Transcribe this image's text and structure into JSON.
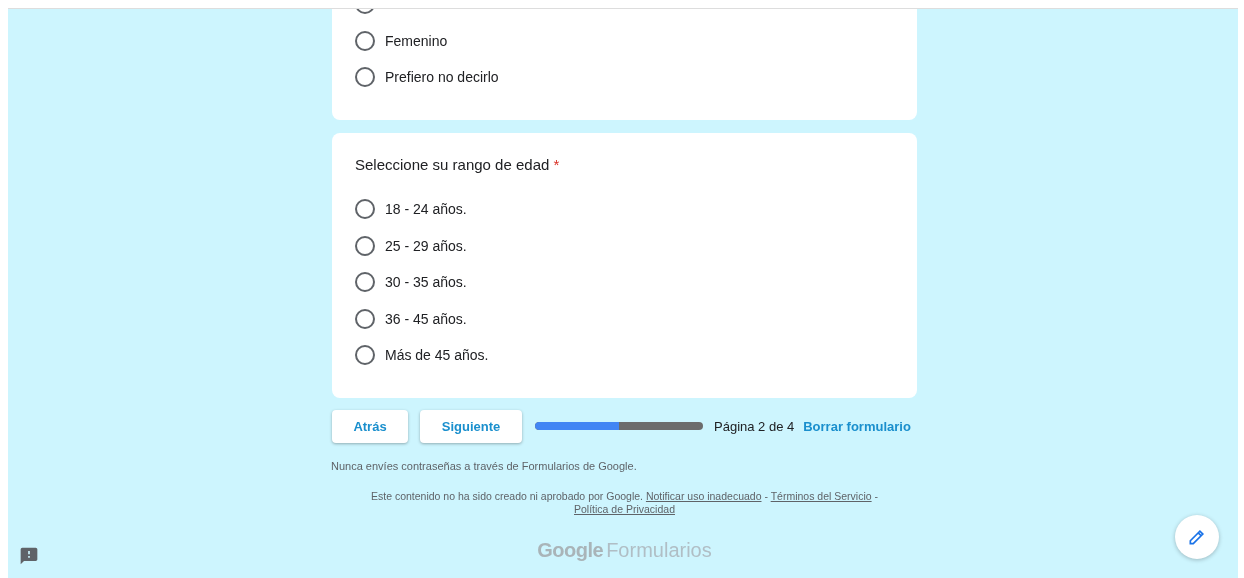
{
  "sections": [
    {
      "options": [
        {
          "selected": false
        },
        {
          "label": "Femenino",
          "selected": false
        },
        {
          "label": "Prefiero no decirlo",
          "selected": false
        }
      ]
    },
    {
      "question": "Seleccione su rango de edad",
      "required_mark": "*",
      "options": [
        {
          "label": "18 - 24 años.",
          "selected": false
        },
        {
          "label": "25 - 29 años.",
          "selected": false
        },
        {
          "label": "30 - 35 años.",
          "selected": false
        },
        {
          "label": "36 - 45 años.",
          "selected": false
        },
        {
          "label": "Más de 45 años.",
          "selected": false
        }
      ]
    }
  ],
  "navigation": {
    "back": "Atrás",
    "next": "Siguiente",
    "progress": {
      "level": 0.5
    },
    "page_label": "Página 2 de 4",
    "clear": "Borrar formulario"
  },
  "footer": {
    "warning": "Nunca envíes contraseñas a través de Formularios de Google.",
    "disclaimer": "Este contenido no ha sido creado ni aprobado por Google.",
    "links": [
      "Notificar uso inadecuado",
      "Términos del Servicio",
      "Política de Privacidad"
    ],
    "separator": "-",
    "logo_google": "Google",
    "logo_product": "Formularios"
  }
}
